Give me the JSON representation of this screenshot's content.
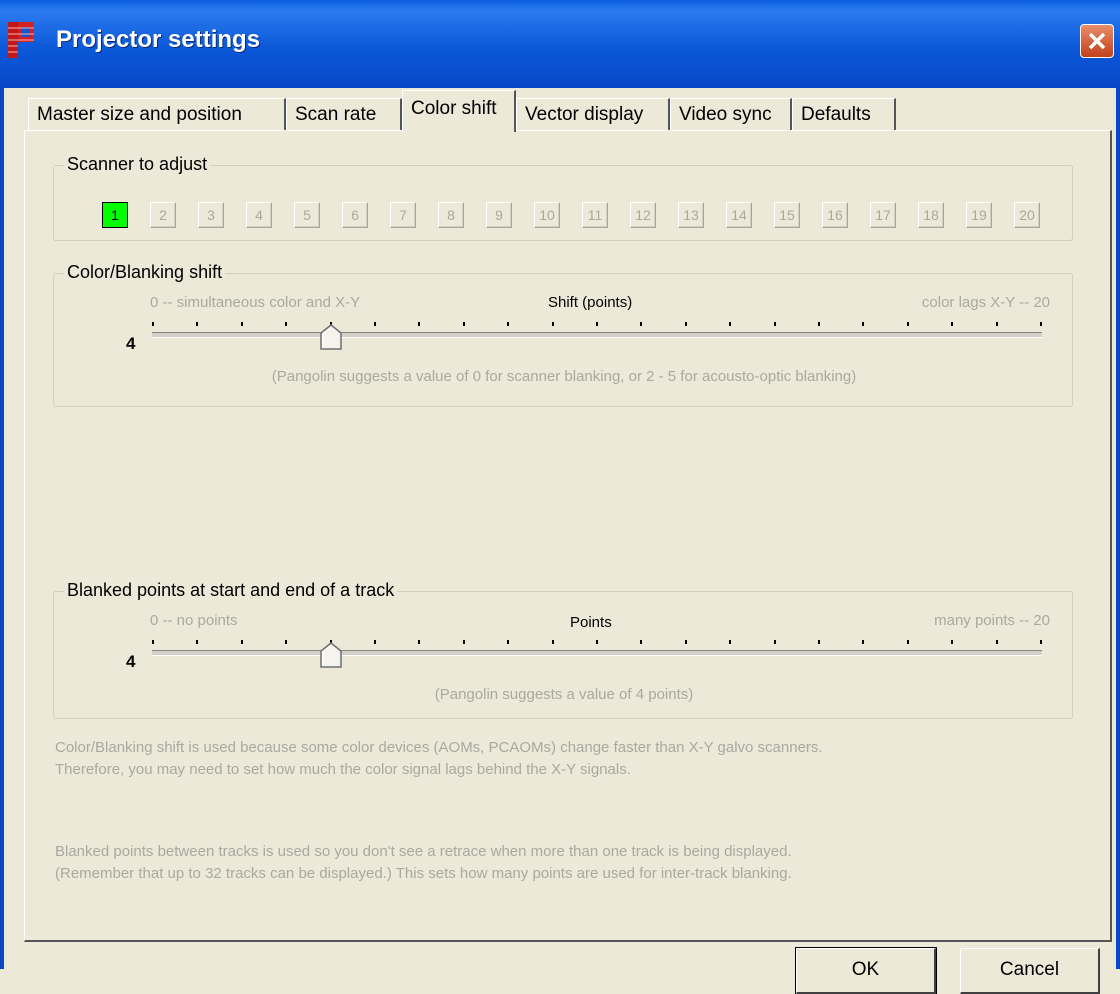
{
  "window": {
    "title": "Projector settings"
  },
  "tabs": [
    {
      "label": "Master size and position"
    },
    {
      "label": "Scan rate"
    },
    {
      "label": "Color shift"
    },
    {
      "label": "Vector display"
    },
    {
      "label": "Video sync"
    },
    {
      "label": "Defaults"
    }
  ],
  "active_tab": "Color shift",
  "scanner_group": {
    "label": "Scanner to adjust",
    "buttons": [
      "1",
      "2",
      "3",
      "4",
      "5",
      "6",
      "7",
      "8",
      "9",
      "10",
      "11",
      "12",
      "13",
      "14",
      "15",
      "16",
      "17",
      "18",
      "19",
      "20"
    ],
    "selected": "1"
  },
  "color_shift_group": {
    "label": "Color/Blanking shift",
    "min_label": "0 -- simultaneous color and X-Y",
    "center_label": "Shift (points)",
    "max_label": "color lags X-Y -- 20",
    "value": "4",
    "slider_value": 4,
    "slider_min": 0,
    "slider_max": 20,
    "note": "(Pangolin suggests a value of 0 for scanner blanking, or 2 - 5 for acousto-optic blanking)"
  },
  "blanked_group": {
    "label": "Blanked points at start and end of a track",
    "min_label": "0 -- no points",
    "center_label": "Points",
    "max_label": "many points -- 20",
    "value": "4",
    "slider_value": 4,
    "slider_min": 0,
    "slider_max": 20,
    "note": "(Pangolin suggests a value of 4 points)"
  },
  "help": {
    "color_shift_line1": "Color/Blanking shift is used because some color devices (AOMs, PCAOMs) change faster than X-Y galvo scanners.",
    "color_shift_line2": "Therefore, you may need to set how much the color signal lags behind the X-Y signals.",
    "blanked_line1": "Blanked points between tracks is used so you don't see a retrace when more than one track is being displayed.",
    "blanked_line2": "(Remember that up to 32 tracks can be displayed.) This sets how many points are used for inter-track blanking."
  },
  "buttons": {
    "ok": "OK",
    "cancel": "Cancel"
  }
}
